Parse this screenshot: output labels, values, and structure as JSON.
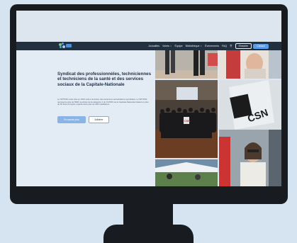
{
  "nav": {
    "links": [
      "Actualités",
      "Volets",
      "Équipe",
      "Bibliothèque",
      "Événements",
      "FAQ"
    ],
    "join_label": "S'inscrire",
    "contact_label": "Contact"
  },
  "hero": {
    "title": "Syndicat des professionnèles, techniciennes et techniciens de la santé et des services sociaux de la Capitale-Nationale",
    "description": "Le SPTSSS a été créé en 2016 suite à la fusion des anciennes accréditations syndicales. Le SPTSSS représente plus de 5000 membres de la catégorie 4 du CIUSSS de la Capitale-Nationale faisant en plus de 60 titres d'emploi, répartis dans plus de 200 installations.",
    "primary_button": "En savoir plus",
    "secondary_button": "Adhérer"
  },
  "photos": {
    "group_photo_sign": "CSN",
    "flag_text": "CSN"
  },
  "colors": {
    "navbar": "#22303f",
    "accent": "#5b9ce6",
    "hero_background": "#e3ebf4",
    "title": "#1f2f46"
  }
}
